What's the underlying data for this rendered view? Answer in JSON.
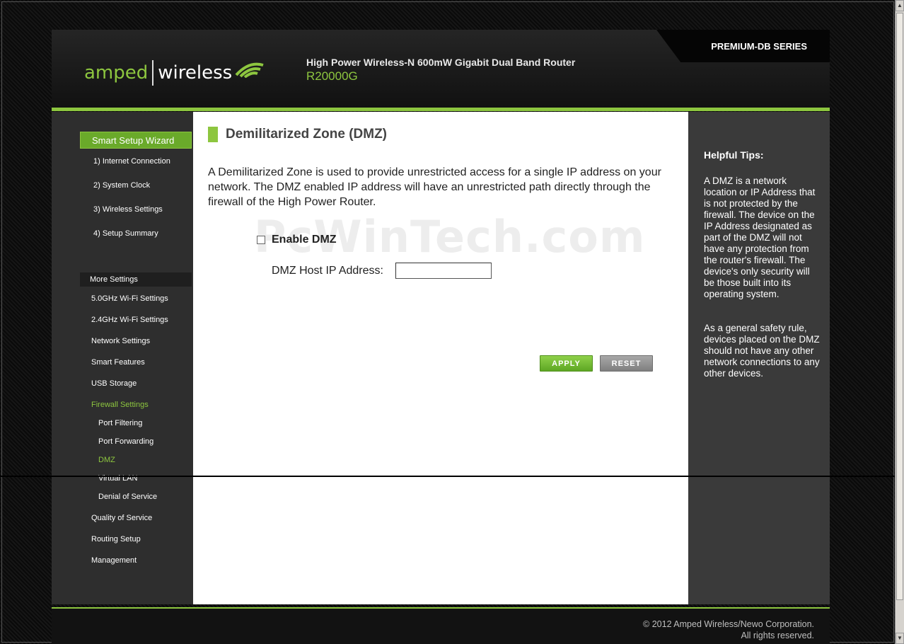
{
  "header": {
    "series": "PREMIUM-DB SERIES",
    "logo_amped": "amped",
    "logo_wireless": "wireless",
    "product_line": "High Power Wireless-N 600mW Gigabit Dual Band Router",
    "model": "R20000G"
  },
  "sidebar": {
    "wizard_title": "Smart Setup Wizard",
    "wizard_items": [
      "1) Internet Connection",
      "2) System Clock",
      "3) Wireless Settings",
      "4) Setup Summary"
    ],
    "more_title": "More Settings",
    "items": [
      "5.0GHz Wi-Fi Settings",
      "2.4GHz Wi-Fi Settings",
      "Network Settings",
      "Smart Features",
      "USB Storage",
      "Firewall Settings",
      "Port Filtering",
      "Port Forwarding",
      "DMZ",
      "Virtual LAN",
      "Denial of Service",
      "Quality of Service",
      "Routing Setup",
      "Management"
    ]
  },
  "content": {
    "title": "Demilitarized Zone (DMZ)",
    "description": "A Demilitarized Zone is used to provide unrestricted access for a single IP address on your network. The DMZ enabled IP address will have an unrestricted path directly through the firewall of the High Power Router.",
    "watermark": "PcWinTech.com",
    "enable_label": "Enable DMZ",
    "enable_checked": false,
    "host_label": "DMZ Host IP Address:",
    "host_value": "",
    "apply_label": "APPLY",
    "reset_label": "RESET"
  },
  "tips": {
    "title": "Helpful Tips:",
    "p1": "A DMZ is a network location or IP Address that is not protected by the firewall. The device on the IP Address designated as part of the DMZ will not have any protection from the router's firewall. The device's only security will be those built into its operating system.",
    "p2": "As a general safety rule, devices placed on the DMZ should not have any other network connections to any other devices."
  },
  "footer": {
    "copyright_line1": "© 2012 Amped Wireless/Newo Corporation.",
    "copyright_line2": "All rights reserved."
  },
  "colors": {
    "accent_green": "#8dc63f",
    "dark_bg": "#2e2e2e",
    "tips_bg": "#3a3a3a"
  }
}
